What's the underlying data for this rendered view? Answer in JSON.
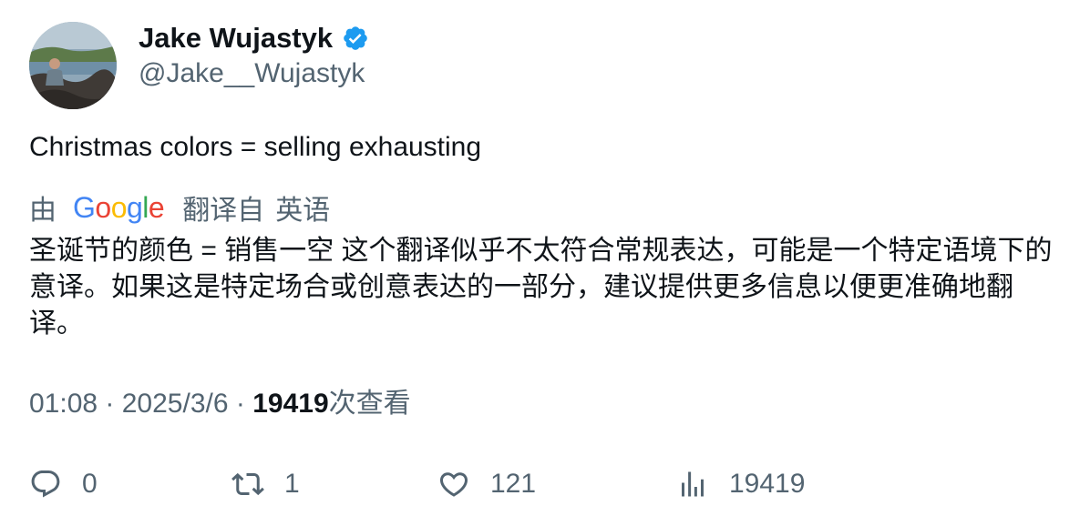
{
  "author": {
    "display_name": "Jake Wujastyk",
    "handle": "@Jake__Wujastyk",
    "verified": true,
    "verified_color": "#1d9bf0"
  },
  "tweet": {
    "text": "Christmas colors = selling exhausting"
  },
  "translation": {
    "by_label": "由",
    "provider": "Google",
    "from_label": "翻译自",
    "source_language": "英语",
    "text": "圣诞节的颜色 = 销售一空 这个翻译似乎不太符合常规表达，可能是一个特定语境下的意译。如果这是特定场合或创意表达的一部分，建议提供更多信息以便更准确地翻译。"
  },
  "meta": {
    "time": "01:08",
    "separator": " · ",
    "date": "2025/3/6",
    "views_count": "19419",
    "views_label": "次查看"
  },
  "actions": {
    "replies": "0",
    "retweets": "1",
    "likes": "121",
    "views": "19419"
  },
  "colors": {
    "text_primary": "#0f1419",
    "text_secondary": "#536471"
  }
}
